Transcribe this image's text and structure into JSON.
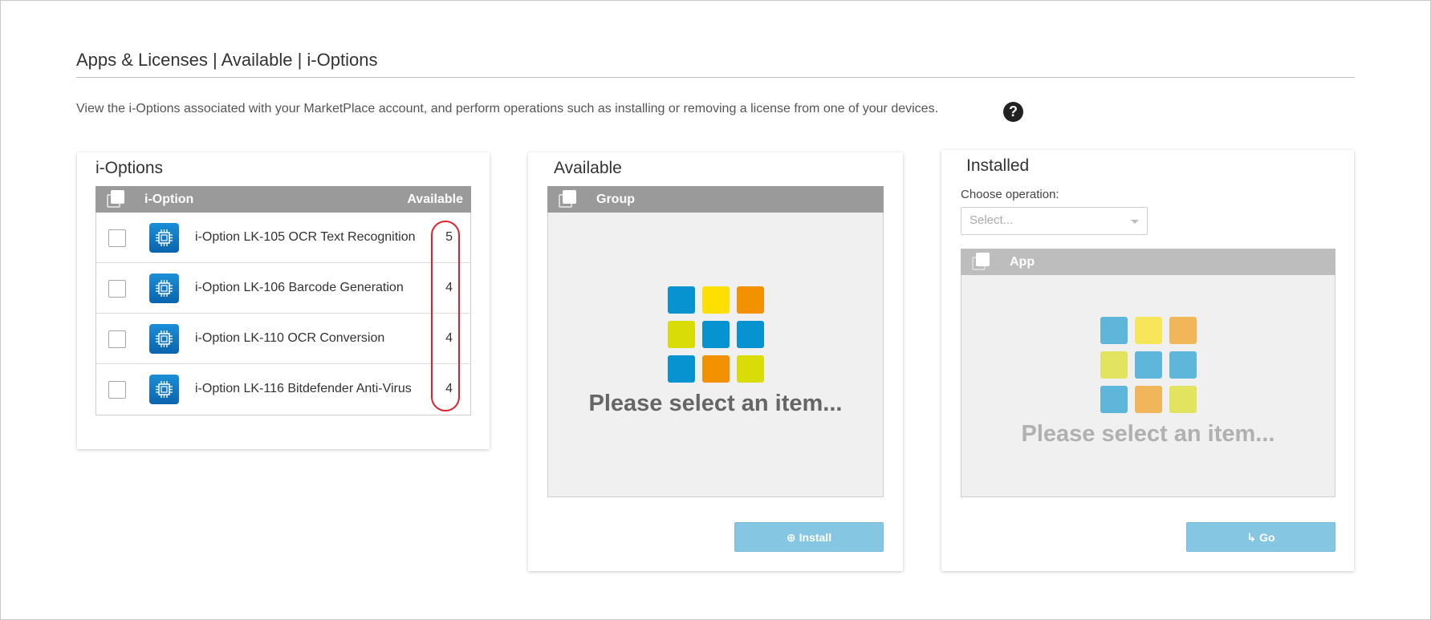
{
  "header": {
    "title": "Apps & Licenses | Available | i-Options",
    "description": "View the i-Options associated with your MarketPlace account, and perform operations such as installing or removing a license from one of your devices.",
    "help_icon": "question-circle-icon"
  },
  "ioptions_panel": {
    "title": "i-Options",
    "col_name": "i-Option",
    "col_available": "Available",
    "rows": [
      {
        "name": "i-Option LK-105 OCR Text Recognition",
        "available": "5",
        "icon": "chip-icon"
      },
      {
        "name": "i-Option LK-106 Barcode Generation",
        "available": "4",
        "icon": "chip-icon"
      },
      {
        "name": "i-Option LK-110 OCR Conversion",
        "available": "4",
        "icon": "chip-icon"
      },
      {
        "name": "i-Option LK-116 Bitdefender Anti-Virus",
        "available": "4",
        "icon": "chip-icon"
      }
    ]
  },
  "available_panel": {
    "title": "Available",
    "col_group": "Group",
    "empty_text": "Please select an item...",
    "button_label": "Install",
    "button_icon": "plus-circle-icon"
  },
  "installed_panel": {
    "title": "Installed",
    "operation_label": "Choose operation:",
    "operation_placeholder": "Select...",
    "col_app": "App",
    "empty_text": "Please select an item...",
    "button_label": "Go",
    "button_icon": "return-arrow-icon"
  },
  "colors": {
    "tile_blue": "#0793cf",
    "tile_yellow": "#fde000",
    "tile_orange": "#f39200",
    "tile_lime": "#dadc08",
    "header_gray": "#9a9a9a",
    "button_blue": "#85c7e3",
    "highlight_red": "#e0202b"
  }
}
